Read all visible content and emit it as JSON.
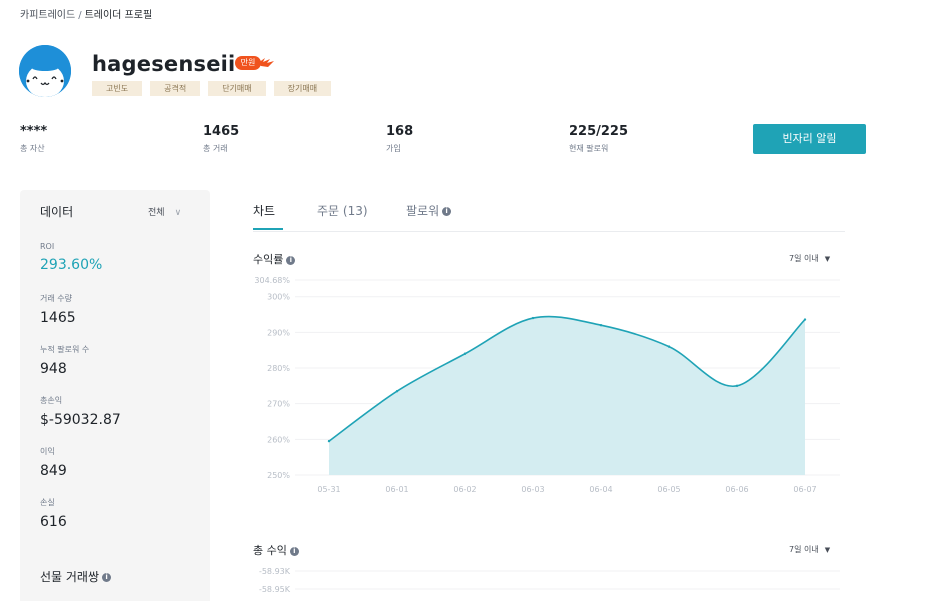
{
  "breadcrumb": {
    "parent": "카피트레이드",
    "separator": "/",
    "current": "트레이더 프로필"
  },
  "profile": {
    "name": "hagesenseii",
    "badge": "만원",
    "tags": [
      "고빈도",
      "공격적",
      "단기매매",
      "장기매매"
    ]
  },
  "stats": [
    {
      "value": "****",
      "label": "총 자산"
    },
    {
      "value": "1465",
      "label": "총 거래"
    },
    {
      "value": "168",
      "label": "가입"
    },
    {
      "value": "225/225",
      "label": "현재 팔로워"
    }
  ],
  "alert_button": "빈자리 알림",
  "sidebar": {
    "title": "데이터",
    "filter": "전체",
    "metrics": [
      {
        "label": "ROI",
        "value": "293.60%",
        "accent": true
      },
      {
        "label": "거래 수량",
        "value": "1465"
      },
      {
        "label": "누적 팔로워 수",
        "value": "948"
      },
      {
        "label": "총손익",
        "value": "$-59032.87"
      },
      {
        "label": "이익",
        "value": "849"
      },
      {
        "label": "손실",
        "value": "616"
      }
    ],
    "futures_title": "선물 거래쌍"
  },
  "tabs": [
    {
      "label": "차트",
      "active": true
    },
    {
      "label": "주문 (13)",
      "active": false
    },
    {
      "label": "팔로워",
      "active": false,
      "info": true
    }
  ],
  "roi_section": {
    "title": "수익률",
    "range": "7일 이내"
  },
  "profit_section": {
    "title": "총 수익",
    "range": "7일 이내"
  },
  "colors": {
    "accent": "#1fa3b6",
    "fill": "#d4edf1",
    "badge": "#f0531e",
    "tag_bg": "#f5ecdc"
  },
  "chart_data": [
    {
      "type": "area",
      "title": "수익률",
      "x": [
        "05-31",
        "06-01",
        "06-02",
        "06-03",
        "06-04",
        "06-05",
        "06-06",
        "06-07"
      ],
      "values": [
        259.5,
        273.5,
        284.0,
        294.0,
        292.0,
        286.0,
        275.0,
        293.6
      ],
      "ylim": [
        250,
        304.68
      ],
      "yticks": [
        "250%",
        "260%",
        "270%",
        "280%",
        "290%",
        "300%"
      ],
      "max_label": "304.68%",
      "grid": true
    },
    {
      "type": "line",
      "title": "총 수익",
      "yticks": [
        "-58.93K",
        "-58.95K"
      ]
    }
  ]
}
